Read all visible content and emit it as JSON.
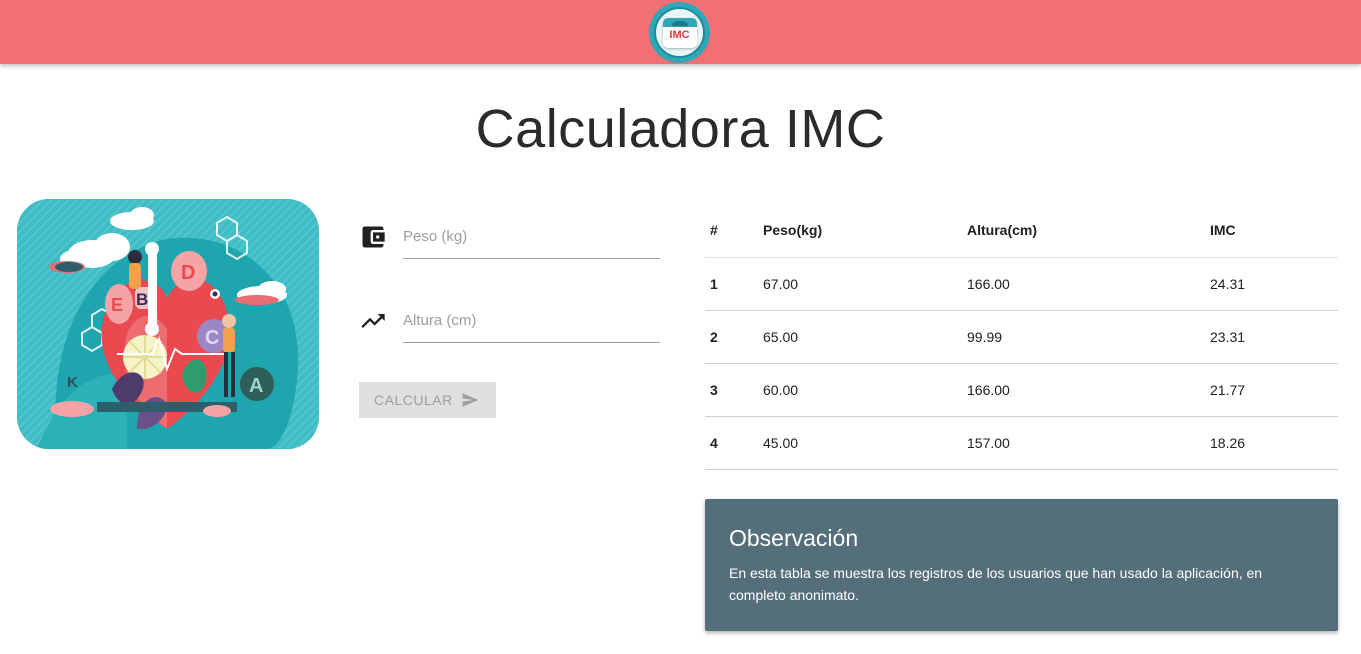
{
  "navbar": {
    "logo_text": "IMC",
    "colors": {
      "background": "#f07073",
      "logo_ring": "#2fa7b6"
    }
  },
  "page": {
    "title": "Calculadora IMC"
  },
  "illustration": {
    "letters": [
      "B",
      "D",
      "E",
      "C",
      "K",
      "A"
    ]
  },
  "form": {
    "weight": {
      "placeholder": "Peso (kg)",
      "value": "",
      "icon": "wallet-icon"
    },
    "height": {
      "placeholder": "Altura (cm)",
      "value": "",
      "icon": "trending-up-icon"
    },
    "submit": {
      "label": "CALCULAR",
      "icon": "send-icon",
      "disabled": true
    }
  },
  "table": {
    "headers": [
      "#",
      "Peso(kg)",
      "Altura(cm)",
      "IMC"
    ],
    "rows": [
      [
        "1",
        "67.00",
        "166.00",
        "24.31"
      ],
      [
        "2",
        "65.00",
        "99.99",
        "23.31"
      ],
      [
        "3",
        "60.00",
        "166.00",
        "21.77"
      ],
      [
        "4",
        "45.00",
        "157.00",
        "18.26"
      ]
    ]
  },
  "observation": {
    "title": "Observación",
    "text": "En esta tabla se muestra los registros de los usuarios que han usado la aplicación, en completo anonimato.",
    "color": "#546e7a"
  }
}
